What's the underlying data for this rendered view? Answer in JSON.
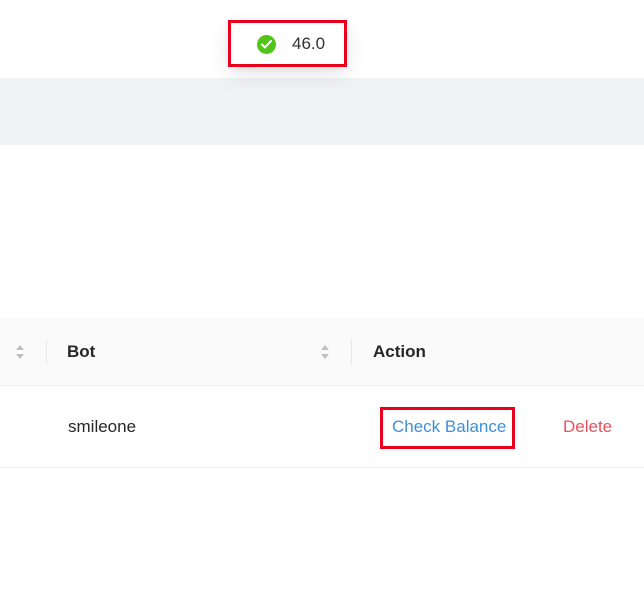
{
  "toast": {
    "icon": "check-circle-icon",
    "message": "46.0",
    "color": "#52c41a"
  },
  "table": {
    "columns": [
      {
        "label": "",
        "sortable": true
      },
      {
        "label": "Bot",
        "sortable": true
      },
      {
        "label": "Action",
        "sortable": false
      }
    ],
    "rows": [
      {
        "bot": "smileone",
        "actions": [
          "Check Balance",
          "Delete"
        ]
      }
    ]
  },
  "colors": {
    "link": "#3e8fd8",
    "danger": "#e8505b",
    "highlight": "#e8001c",
    "band": "#f0f2f5"
  }
}
